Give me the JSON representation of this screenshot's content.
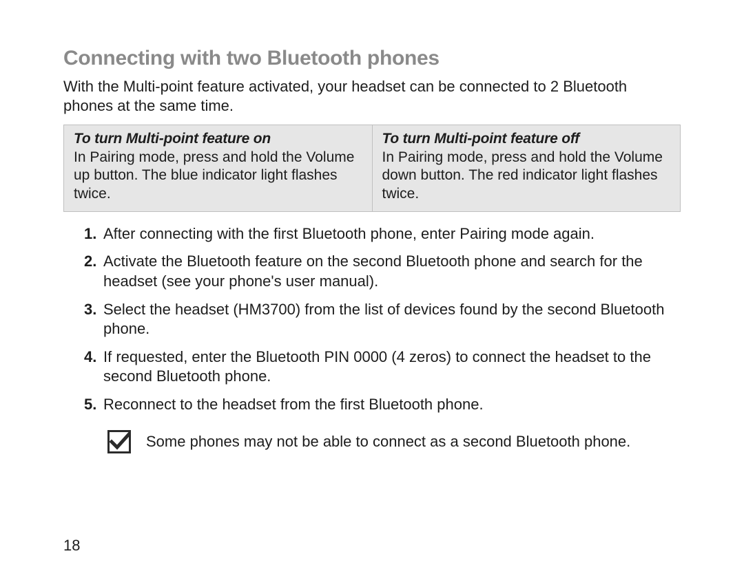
{
  "heading": "Connecting with two Bluetooth phones",
  "intro": "With the Multi-point feature activated, your headset can be connected to 2 Bluetooth phones at the same time.",
  "table": {
    "left": {
      "title": "To turn Multi-point feature on",
      "body": "In Pairing mode, press and hold the Volume up button. The blue indicator light flashes twice."
    },
    "right": {
      "title": "To turn Multi-point feature off",
      "body": "In Pairing mode, press and hold the Volume down button. The red indicator light flashes twice."
    }
  },
  "steps": [
    {
      "num": "1.",
      "text": "After connecting with the first Bluetooth phone, enter Pairing mode again."
    },
    {
      "num": "2.",
      "text": "Activate the Bluetooth feature on the second Bluetooth phone and search for the headset (see your phone's user manual)."
    },
    {
      "num": "3.",
      "text": "Select the headset (HM3700) from the list of devices found by the second Bluetooth phone."
    },
    {
      "num": "4.",
      "text": "If requested, enter the Bluetooth PIN 0000 (4 zeros) to connect the headset to the second Bluetooth phone."
    },
    {
      "num": "5.",
      "text": "Reconnect to the headset from the first Bluetooth phone."
    }
  ],
  "note": "Some phones may not be able to connect as a second Bluetooth phone.",
  "page_number": "18"
}
